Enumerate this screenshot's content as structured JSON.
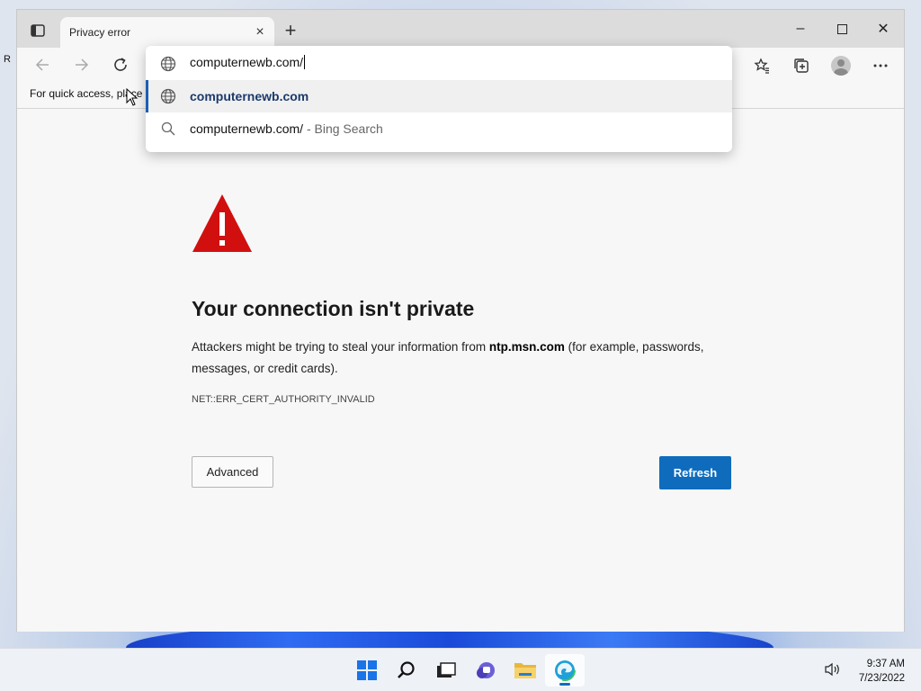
{
  "desktop": {
    "icon_label_partial": "R"
  },
  "browser": {
    "tab": {
      "title": "Privacy error",
      "close_glyph": "×"
    },
    "new_tab_glyph": "+",
    "window_controls": {
      "minimize": "–",
      "maximize": "☐",
      "close": "✕"
    },
    "favorites_bar_text": "For quick access, place y",
    "omnibox": {
      "value": "computernewb.com/",
      "suggestions": [
        {
          "icon": "globe-icon",
          "text": "computernewb.com",
          "sub": "",
          "selected": true
        },
        {
          "icon": "search-icon",
          "text": "computernewb.com/",
          "sub": " - Bing Search",
          "selected": false
        }
      ]
    }
  },
  "error_page": {
    "title": "Your connection isn't private",
    "body_prefix": "Attackers might be trying to steal your information from ",
    "host": "ntp.msn.com",
    "body_suffix": " (for example, passwords, messages, or credit cards).",
    "error_code": "NET::ERR_CERT_AUTHORITY_INVALID",
    "advanced_label": "Advanced",
    "refresh_label": "Refresh",
    "warning_color": "#d20f0f",
    "accent_color": "#0f6cbd"
  },
  "taskbar": {
    "icons": [
      "start-icon",
      "search-icon",
      "task-view-icon",
      "chat-icon",
      "file-explorer-icon",
      "edge-icon"
    ],
    "time": "9:37 AM",
    "date": "7/23/2022"
  }
}
